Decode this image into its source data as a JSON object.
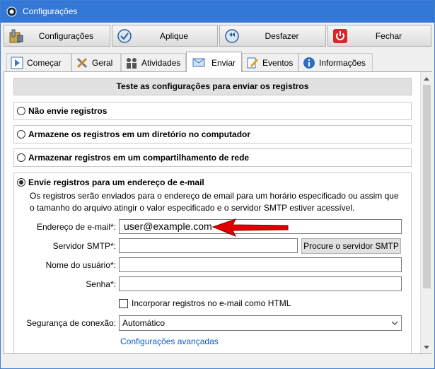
{
  "window": {
    "title": "Configurações"
  },
  "toolbar": {
    "configuracoes_label": "Configurações",
    "aplique_label": "Aplique",
    "desfazer_label": "Desfazer",
    "fechar_label": "Fechar"
  },
  "tabs": [
    {
      "label": "Começar"
    },
    {
      "label": "Geral"
    },
    {
      "label": "Atividades"
    },
    {
      "label": "Enviar"
    },
    {
      "label": "Eventos"
    },
    {
      "label": "Informações"
    }
  ],
  "panel": {
    "header": "Teste as configurações para enviar os registros",
    "options": [
      {
        "label": "Não envie registros",
        "selected": false
      },
      {
        "label": "Armazene os registros em um diretório no computador",
        "selected": false
      },
      {
        "label": "Armazenar registros em um compartilhamento de rede",
        "selected": false
      },
      {
        "label": "Envie registros para um endereço de e-mail",
        "selected": true
      }
    ],
    "email_description": "Os registros serão enviados para o endereço de email para um horário especificado ou assim que o tamanho do arquivo atingir o valor especificado e o servidor SMTP estiver acessível.",
    "fields": {
      "email_label": "Endereço de e-mail*:",
      "email_value": "user@example.com",
      "smtp_label": "Servidor SMTP*:",
      "smtp_value": "",
      "smtp_button": "Procure o servidor SMTP",
      "username_label": "Nome do usuário*:",
      "username_value": "",
      "password_label": "Senha*:",
      "password_value": ""
    },
    "html_checkbox": {
      "label": "Incorporar registros no e-mail como HTML",
      "checked": false
    },
    "security": {
      "label": "Segurança de conexão:",
      "value": "Automático"
    },
    "advanced_link": "Configurações avançadas"
  },
  "colors": {
    "titlebar": "#3478d7",
    "link": "#0b5cc5",
    "arrow": "#e00000"
  }
}
